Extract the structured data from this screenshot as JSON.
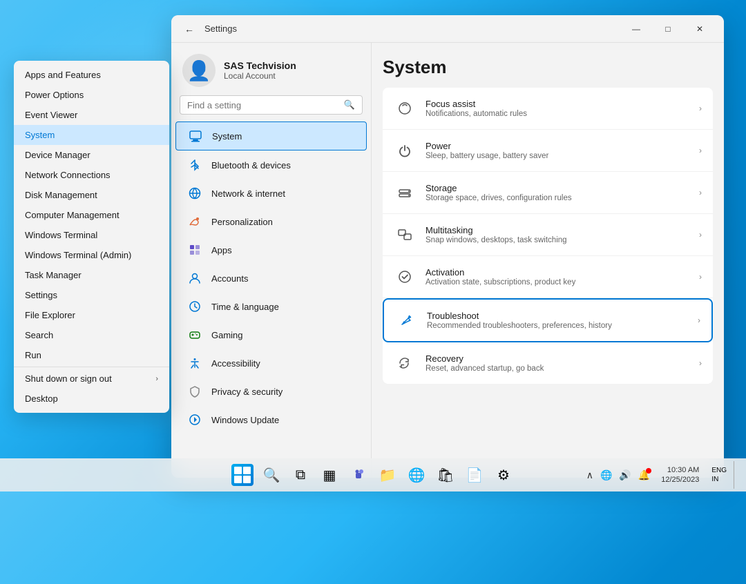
{
  "background": {
    "gradient": "windows11-blue"
  },
  "context_menu": {
    "items": [
      {
        "id": "apps-features",
        "label": "Apps and Features",
        "selected": false
      },
      {
        "id": "power-options",
        "label": "Power Options",
        "selected": false
      },
      {
        "id": "event-viewer",
        "label": "Event Viewer",
        "selected": false
      },
      {
        "id": "system",
        "label": "System",
        "selected": true
      },
      {
        "id": "device-manager",
        "label": "Device Manager",
        "selected": false
      },
      {
        "id": "network-connections",
        "label": "Network Connections",
        "selected": false
      },
      {
        "id": "disk-management",
        "label": "Disk Management",
        "selected": false
      },
      {
        "id": "computer-management",
        "label": "Computer Management",
        "selected": false
      },
      {
        "id": "windows-terminal",
        "label": "Windows Terminal",
        "selected": false
      },
      {
        "id": "windows-terminal-admin",
        "label": "Windows Terminal (Admin)",
        "selected": false
      },
      {
        "id": "task-manager",
        "label": "Task Manager",
        "selected": false
      },
      {
        "id": "settings",
        "label": "Settings",
        "selected": false
      },
      {
        "id": "file-explorer",
        "label": "File Explorer",
        "selected": false
      },
      {
        "id": "search",
        "label": "Search",
        "selected": false
      },
      {
        "id": "run",
        "label": "Run",
        "selected": false
      },
      {
        "id": "divider",
        "label": "",
        "selected": false
      },
      {
        "id": "shut-down",
        "label": "Shut down or sign out",
        "selected": false,
        "hasArrow": true
      },
      {
        "id": "desktop",
        "label": "Desktop",
        "selected": false
      }
    ]
  },
  "settings_window": {
    "title": "Settings",
    "back_label": "←",
    "controls": {
      "minimize": "—",
      "maximize": "□",
      "close": "✕"
    },
    "user": {
      "name": "SAS Techvision",
      "account_type": "Local Account"
    },
    "search": {
      "placeholder": "Find a setting",
      "icon": "🔍"
    },
    "nav_items": [
      {
        "id": "system",
        "label": "System",
        "icon": "🖥",
        "active": true
      },
      {
        "id": "bluetooth",
        "label": "Bluetooth & devices",
        "icon": "🦷",
        "active": false
      },
      {
        "id": "network",
        "label": "Network & internet",
        "icon": "🌐",
        "active": false
      },
      {
        "id": "personalization",
        "label": "Personalization",
        "icon": "🖌",
        "active": false
      },
      {
        "id": "apps",
        "label": "Apps",
        "icon": "📦",
        "active": false
      },
      {
        "id": "accounts",
        "label": "Accounts",
        "icon": "👤",
        "active": false
      },
      {
        "id": "time-language",
        "label": "Time & language",
        "icon": "🕐",
        "active": false
      },
      {
        "id": "gaming",
        "label": "Gaming",
        "icon": "🎮",
        "active": false
      },
      {
        "id": "accessibility",
        "label": "Accessibility",
        "icon": "♿",
        "active": false
      },
      {
        "id": "privacy",
        "label": "Privacy & security",
        "icon": "🛡",
        "active": false
      },
      {
        "id": "windows-update",
        "label": "Windows Update",
        "icon": "🔄",
        "active": false
      }
    ],
    "main": {
      "title": "System",
      "items": [
        {
          "id": "focus-assist",
          "title": "Focus assist",
          "desc": "Notifications, automatic rules",
          "icon": "🌙",
          "highlighted": false
        },
        {
          "id": "power",
          "title": "Power",
          "desc": "Sleep, battery usage, battery saver",
          "icon": "⏻",
          "highlighted": false
        },
        {
          "id": "storage",
          "title": "Storage",
          "desc": "Storage space, drives, configuration rules",
          "icon": "💾",
          "highlighted": false
        },
        {
          "id": "multitasking",
          "title": "Multitasking",
          "desc": "Snap windows, desktops, task switching",
          "icon": "⧉",
          "highlighted": false
        },
        {
          "id": "activation",
          "title": "Activation",
          "desc": "Activation state, subscriptions, product key",
          "icon": "✅",
          "highlighted": false
        },
        {
          "id": "troubleshoot",
          "title": "Troubleshoot",
          "desc": "Recommended troubleshooters, preferences, history",
          "icon": "🔧",
          "highlighted": true
        },
        {
          "id": "recovery",
          "title": "Recovery",
          "desc": "Reset, advanced startup, go back",
          "icon": "♻",
          "highlighted": false
        }
      ]
    }
  },
  "taskbar": {
    "start_icon": "⊞",
    "search_icon": "🔍",
    "task_view_icon": "⧉",
    "widgets_icon": "▦",
    "teams_icon": "👥",
    "pinned_apps": [
      {
        "id": "file-explorer",
        "icon": "📁"
      },
      {
        "id": "edge",
        "icon": "🌐"
      },
      {
        "id": "store",
        "icon": "🛍"
      },
      {
        "id": "mail",
        "icon": "📄"
      },
      {
        "id": "settings-app",
        "icon": "⚙"
      }
    ],
    "sys_tray": {
      "chevron": "∧",
      "network": "🌐",
      "lang": "ENG\nIN",
      "notification": "🔔",
      "time": "10:30 AM",
      "date": "12/25/2023"
    }
  }
}
